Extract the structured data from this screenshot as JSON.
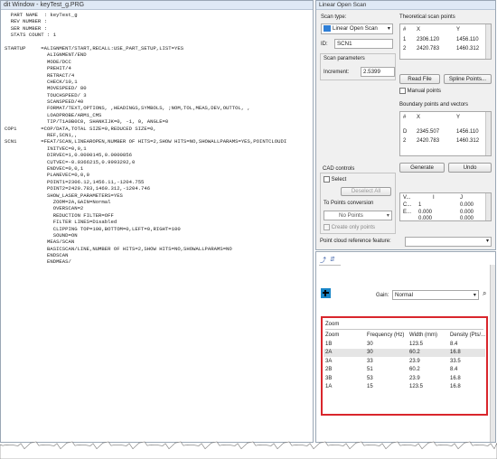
{
  "editor": {
    "title": "dit Window - keyTest_g.PRG",
    "lines": [
      {
        "t": "  PART NAME  : keyTest_g"
      },
      {
        "t": "  REV NUMBER :"
      },
      {
        "t": "  SER NUMBER :"
      },
      {
        "t": "  STATS COUNT : 1"
      },
      {
        "t": ""
      },
      {
        "t": "STARTUP     =ALIGNMENT/START,RECALL:USE_PART_SETUP,LIST=YES"
      },
      {
        "t": "              ALIGNMENT/END"
      },
      {
        "t": "              MODE/DCC"
      },
      {
        "t": "              PREHIT/4"
      },
      {
        "t": "              RETRACT/4"
      },
      {
        "t": "              CHECK/10,1"
      },
      {
        "t": "              MOVESPEED/ 80"
      },
      {
        "t": "              TOUCHSPEED/ 3"
      },
      {
        "t": "              SCANSPEED/40"
      },
      {
        "t": "              FORMAT/TEXT,OPTIONS, ,HEADINGS,SYMBOLS, ;NOM,TOL,MEAS,DEV,OUTTOL, ,"
      },
      {
        "t": "              LOADPROBE/ARM1_CMS"
      },
      {
        "t": "              TIP/T1A0B0C0, SHANKIJK=0, -1, 0, ANGLE=0"
      },
      {
        "t": "COP1        =COP/DATA,TOTAL SIZE=0,REDUCED SIZE=0,"
      },
      {
        "t": "              REF,SCN1,,"
      },
      {
        "t": "SCN1        =FEAT/SCAN,LINEAROPEN,NUMBER OF HITS=2,SHOW HITS=NO,SHOWALLPARAMS=YES,POINTCLOUDI"
      },
      {
        "t": "              INITVEC=0,0,1"
      },
      {
        "t": "              DIRVEC=1,0.0000145,0.0000856"
      },
      {
        "t": "              CUTVEC=-0.0366215,0.9993292,0"
      },
      {
        "t": "              ENDVEC=0,0,1"
      },
      {
        "t": "              PLANEVEC=0,0,0"
      },
      {
        "t": "              POINT1=2306.12,1456.11,-1204.755"
      },
      {
        "t": "              POINT2=2420.783,1460.312,-1204.746"
      },
      {
        "t": "              SHOW_LASER_PARAMETERS=YES"
      },
      {
        "t": "                ZOOM=2A,GAIN=Normal"
      },
      {
        "t": "                OVERSCAN=2"
      },
      {
        "t": "                REDUCTION FILTER=OFF"
      },
      {
        "t": "                FILTER LINES=Disabled"
      },
      {
        "t": "                CLIPPING TOP=100,BOTTOM=0,LEFT=0,RIGHT=100"
      },
      {
        "t": "                SOUND=ON"
      },
      {
        "t": "              MEAS/SCAN"
      },
      {
        "t": "              BASICSCAN/LINE,NUMBER OF HITS=2,SHOW HITS=NO,SHOWALLPARAMS=NO"
      },
      {
        "t": "              ENDSCAN"
      },
      {
        "t": "              ENDMEAS/"
      }
    ]
  },
  "panel": {
    "title": "Linear Open Scan",
    "scan_type_label": "Scan type:",
    "scan_type_value": "Linear Open Scan",
    "id_label": "ID:",
    "id_value": "SCN1",
    "scan_params_label": "Scan parameters",
    "increment_label": "Increment:",
    "increment_value": "2.5399",
    "theoretical_label": "Theoretical scan points",
    "theo_headers": [
      "#",
      "X",
      "Y"
    ],
    "theo_rows": [
      [
        "1",
        "2306.120",
        "1456.110"
      ],
      [
        "2",
        "2420.783",
        "1460.312"
      ]
    ],
    "read_file_label": "Read File",
    "spline_points_label": "Spline Points...",
    "manual_points_label": "Manual points",
    "boundary_label": "Boundary points and vectors",
    "boundary_headers": [
      "#",
      "X",
      "Y"
    ],
    "boundary_rows": [
      [
        "D",
        "2345.507",
        "1456.110"
      ],
      [
        "2",
        "2420.783",
        "1460.312"
      ]
    ],
    "generate_label": "Generate",
    "undo_label": "Undo",
    "cad_controls_label": "CAD controls",
    "select_label": "Select",
    "deselect_all_label": "Deselect All",
    "to_points_label": "To Points conversion",
    "no_points_label": "No Points",
    "create_only_points_label": "Create only points",
    "vec_headers": [
      "I",
      "J"
    ],
    "vec_rows": [
      [
        "V...",
        "1",
        "0.000"
      ],
      [
        "C...",
        "0.000",
        "0.000"
      ],
      [
        "E...",
        "0.000",
        "0.000"
      ]
    ],
    "point_cloud_label": "Point cloud reference feature:"
  },
  "zoom_pane": {
    "gain_label": "Gain:",
    "gain_value": "Normal",
    "section_title": "Zoom",
    "headers": [
      "Zoom",
      "Frequency (Hz)",
      "Width (mm)",
      "Density (Pts/..."
    ],
    "rows": [
      [
        "1B",
        "30",
        "123.5",
        "8.4"
      ],
      [
        "2A",
        "30",
        "60.2",
        "16.8"
      ],
      [
        "3A",
        "33",
        "23.9",
        "33.5"
      ],
      [
        "2B",
        "51",
        "60.2",
        "8.4"
      ],
      [
        "3B",
        "53",
        "23.9",
        "16.8"
      ],
      [
        "1A",
        "15",
        "123.5",
        "16.8"
      ]
    ],
    "selected_row": "2A"
  },
  "colors": {
    "highlight_box": "#d9262c",
    "keyword_blue": "#2a2ac0",
    "titlebar": "#dfe9f5"
  }
}
